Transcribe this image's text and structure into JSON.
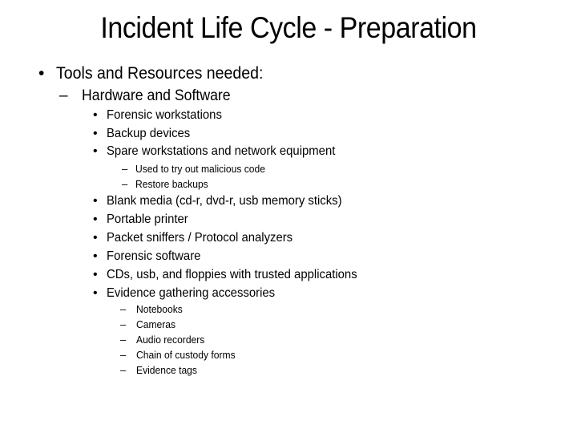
{
  "slide": {
    "title": "Incident Life Cycle - Preparation",
    "bullet_glyph": "•",
    "dash_glyph": "–",
    "level1": "Tools and Resources needed:",
    "level2": "Hardware and Software",
    "group_a": [
      "Forensic workstations",
      "Backup devices",
      "Spare workstations and network equipment"
    ],
    "spare_sub": [
      "Used to try out malicious code",
      "Restore backups"
    ],
    "group_b": [
      "Blank media (cd-r, dvd-r, usb memory sticks)",
      "Portable printer",
      "Packet sniffers / Protocol analyzers",
      "Forensic software",
      "CDs, usb, and floppies with trusted applications",
      "Evidence gathering accessories"
    ],
    "evidence_sub": [
      "Notebooks",
      "Cameras",
      "Audio recorders",
      "Chain of custody forms",
      "Evidence tags"
    ]
  }
}
